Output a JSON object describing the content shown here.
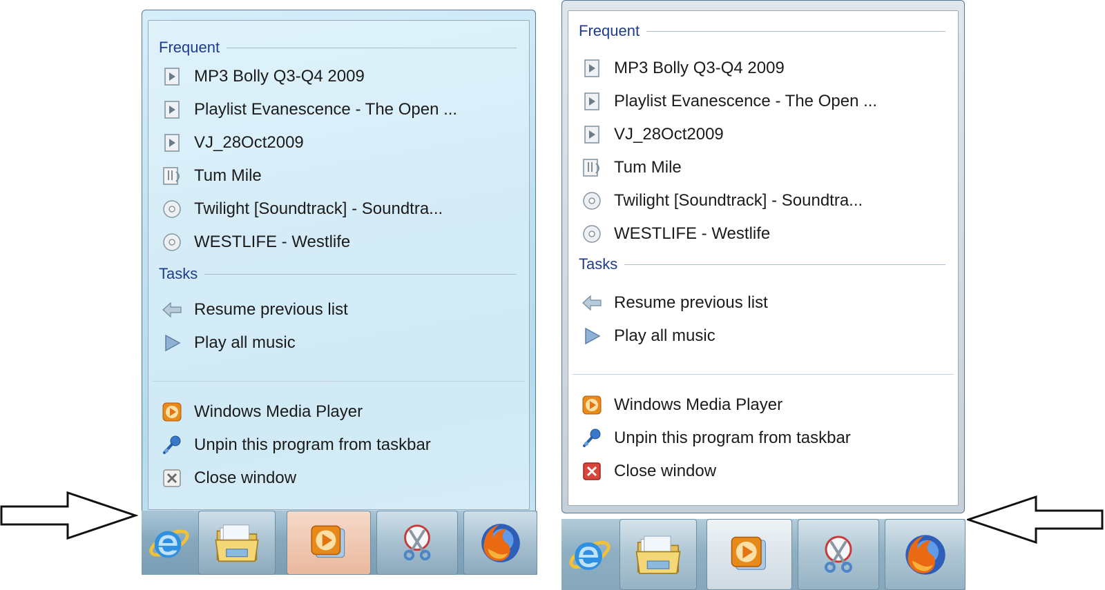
{
  "jumplist": {
    "frequent_title": "Frequent",
    "frequent_items": [
      {
        "label": "MP3 Bolly Q3-Q4 2009",
        "icon": "playlist-icon"
      },
      {
        "label": "Playlist Evanescence - The Open ...",
        "icon": "playlist-icon"
      },
      {
        "label": "VJ_28Oct2009",
        "icon": "playlist-icon"
      },
      {
        "label": "Tum Mile",
        "icon": "music-file-icon"
      },
      {
        "label": "Twilight [Soundtrack] - Soundtra...",
        "icon": "cd-icon"
      },
      {
        "label": "WESTLIFE - Westlife",
        "icon": "cd-icon"
      }
    ],
    "tasks_title": "Tasks",
    "task_items": [
      {
        "label": "Resume previous list",
        "icon": "back-arrow-icon"
      },
      {
        "label": "Play all music",
        "icon": "play-icon"
      }
    ],
    "program_items": [
      {
        "label": "Windows Media Player",
        "icon": "media-player-icon"
      },
      {
        "label": "Unpin this program from taskbar",
        "icon": "unpin-icon"
      },
      {
        "label": "Close window",
        "icon": "close-window-icon"
      }
    ]
  },
  "taskbar": {
    "buttons": [
      {
        "name": "internet-explorer",
        "icon": "internet-explorer-icon"
      },
      {
        "name": "windows-explorer",
        "icon": "folder-icon"
      },
      {
        "name": "windows-media-player",
        "icon": "media-player-icon"
      },
      {
        "name": "snipping-tool",
        "icon": "scissors-icon"
      },
      {
        "name": "firefox",
        "icon": "firefox-icon"
      }
    ]
  },
  "colors": {
    "section_title": "#1e3b8c",
    "item_text": "#1b1b1b",
    "left_panel": "#c0e2f3",
    "right_panel": "#ffffff"
  }
}
